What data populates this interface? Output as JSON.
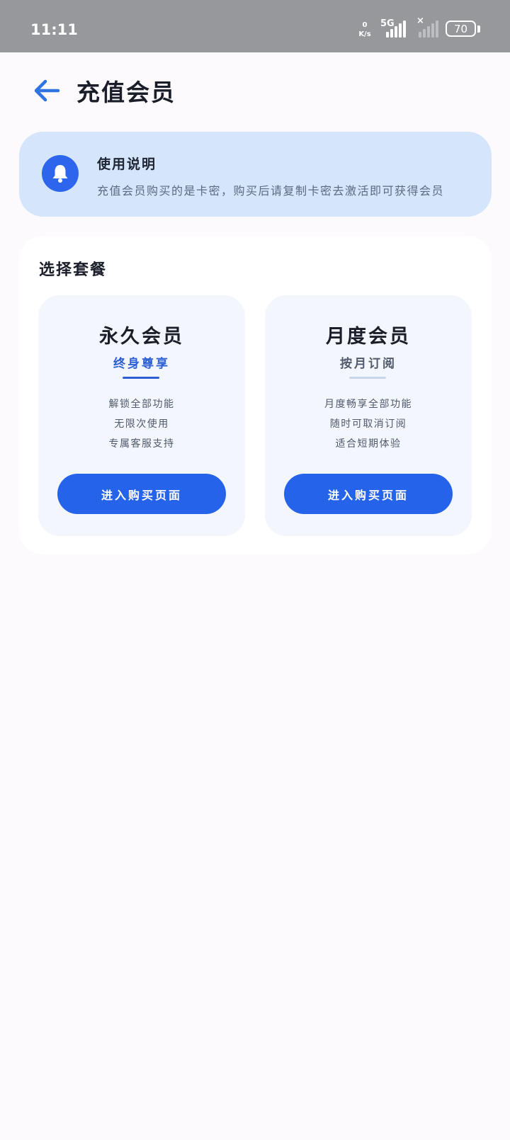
{
  "status_bar": {
    "time": "11:11",
    "net_speed_value": "0",
    "net_speed_unit": "K/s",
    "network_type": "5G",
    "battery_level": "70",
    "no_signal_mark": "×"
  },
  "header": {
    "title": "充值会员",
    "back_icon": "arrow-left-icon"
  },
  "notice": {
    "icon": "bell-icon",
    "title": "使用说明",
    "text": "充值会员购买的是卡密，购买后请复制卡密去激活即可获得会员"
  },
  "plans_section": {
    "title": "选择套餐",
    "plans": [
      {
        "name": "永久会员",
        "subtitle": "终身尊享",
        "features": [
          "解锁全部功能",
          "无限次使用",
          "专属客服支持"
        ],
        "button_label": "进入购买页面"
      },
      {
        "name": "月度会员",
        "subtitle": "按月订阅",
        "features": [
          "月度畅享全部功能",
          "随时可取消订阅",
          "适合短期体验"
        ],
        "button_label": "进入购买页面"
      }
    ]
  },
  "colors": {
    "accent": "#2563eb",
    "notice_bg": "#d5e5fb",
    "premium_subtitle": "#2c5fd3",
    "monthly_subtitle": "#505a6b",
    "premium_divider": "#2c5fd3",
    "monthly_divider": "#c9d6ea"
  }
}
